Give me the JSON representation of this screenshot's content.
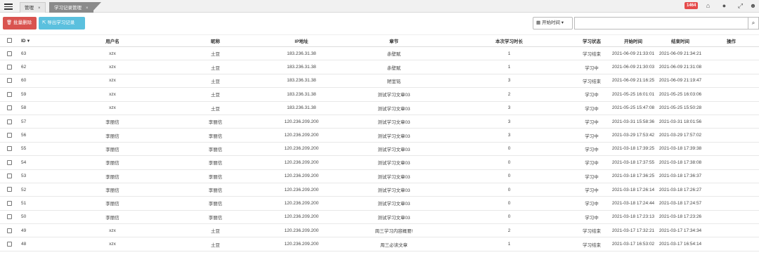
{
  "tabs": [
    {
      "label": "管理",
      "close": "×"
    },
    {
      "label": "学习记录管理",
      "close": "×"
    }
  ],
  "topbar": {
    "badge": "1464",
    "icons": [
      "home-icon",
      "chat-icon",
      "fullscreen-icon",
      "user-icon"
    ]
  },
  "toolbar": {
    "batch_delete": "批量删除",
    "export": "导出学习记录",
    "date_filter": "开始时间",
    "search_placeholder": ""
  },
  "table": {
    "headers": {
      "id": "ID",
      "username": "用户名",
      "nickname": "昵称",
      "ip": "IP地址",
      "chapter": "章节",
      "duration": "本次学习时长",
      "status": "学习状态",
      "start": "开始时间",
      "end": "结束时间",
      "action": "操作"
    },
    "rows": [
      [
        "63",
        "xzx",
        "土豆",
        "183.236.31.38",
        "赤壁赋",
        "1",
        "学习结束",
        "2021-06-09 21:33:01",
        "2021-06-09 21:34:21"
      ],
      [
        "62",
        "xzx",
        "土豆",
        "183.236.31.38",
        "赤壁赋",
        "1",
        "学习中",
        "2021-06-09 21:30:03",
        "2021-06-09 21:31:08"
      ],
      [
        "60",
        "xzx",
        "土豆",
        "183.236.31.38",
        "陋室铭",
        "3",
        "学习结束",
        "2021-06-09 21:16:25",
        "2021-06-09 21:19:47"
      ],
      [
        "59",
        "xzx",
        "土豆",
        "183.236.31.38",
        "测试学习文章03",
        "2",
        "学习中",
        "2021-05-25 16:01:01",
        "2021-05-25 16:03:06"
      ],
      [
        "58",
        "xzx",
        "土豆",
        "183.236.31.38",
        "测试学习文章03",
        "3",
        "学习中",
        "2021-05-25 15:47:08",
        "2021-05-25 15:50:28"
      ],
      [
        "57",
        "李丽信",
        "李丽信",
        "120.236.209.200",
        "测试学习文章03",
        "3",
        "学习中",
        "2021-03-31 15:58:36",
        "2021-03-31 18:01:56"
      ],
      [
        "56",
        "李丽信",
        "李丽信",
        "120.236.209.200",
        "测试学习文章03",
        "3",
        "学习中",
        "2021-03-29 17:53:42",
        "2021-03-29 17:57:02"
      ],
      [
        "55",
        "李丽信",
        "李丽信",
        "120.236.209.200",
        "测试学习文章03",
        "0",
        "学习中",
        "2021-03-18 17:39:25",
        "2021-03-18 17:39:38"
      ],
      [
        "54",
        "李丽信",
        "李丽信",
        "120.236.209.200",
        "测试学习文章03",
        "0",
        "学习中",
        "2021-03-18 17:37:55",
        "2021-03-18 17:38:08"
      ],
      [
        "53",
        "李丽信",
        "李丽信",
        "120.236.209.200",
        "测试学习文章03",
        "0",
        "学习中",
        "2021-03-18 17:36:25",
        "2021-03-18 17:36:37"
      ],
      [
        "52",
        "李丽信",
        "李丽信",
        "120.236.209.200",
        "测试学习文章03",
        "0",
        "学习中",
        "2021-03-18 17:26:14",
        "2021-03-18 17:26:27"
      ],
      [
        "51",
        "李丽信",
        "李丽信",
        "120.236.209.200",
        "测试学习文章03",
        "0",
        "学习中",
        "2021-03-18 17:24:44",
        "2021-03-18 17:24:57"
      ],
      [
        "50",
        "李丽信",
        "李丽信",
        "120.236.209.200",
        "测试学习文章03",
        "0",
        "学习中",
        "2021-03-18 17:23:13",
        "2021-03-18 17:23:26"
      ],
      [
        "49",
        "xzx",
        "土豆",
        "120.236.209.200",
        "周三学习内容概要!",
        "2",
        "学习结束",
        "2021-03-17 17:32:21",
        "2021-03-17 17:34:34"
      ],
      [
        "48",
        "xzx",
        "土豆",
        "120.236.209.200",
        "周三必读文章",
        "1",
        "学习结束",
        "2021-03-17 16:53:02",
        "2021-03-17 16:54:14"
      ]
    ]
  },
  "colors": {
    "danger": "#d9534f",
    "info": "#5bc0de",
    "badge": "#e54b4b"
  }
}
